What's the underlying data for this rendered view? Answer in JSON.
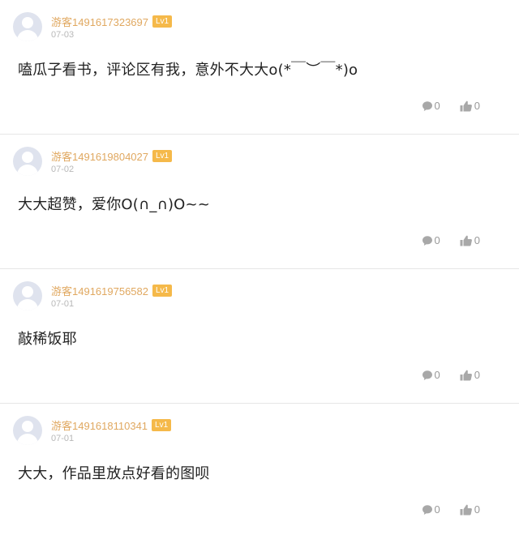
{
  "comments": [
    {
      "username": "游客1491617323697",
      "level": "Lv1",
      "date": "07-03",
      "text": "嗑瓜子看书，评论区有我，意外不大大o(*￣︶￣*)o",
      "reply_count": "0",
      "like_count": "0"
    },
    {
      "username": "游客1491619804027",
      "level": "Lv1",
      "date": "07-02",
      "text": "大大超赞，爱你O(∩_∩)O~~",
      "reply_count": "0",
      "like_count": "0"
    },
    {
      "username": "游客1491619756582",
      "level": "Lv1",
      "date": "07-01",
      "text": "敲稀饭耶",
      "reply_count": "0",
      "like_count": "0"
    },
    {
      "username": "游客1491618110341",
      "level": "Lv1",
      "date": "07-01",
      "text": "大大，作品里放点好看的图呗",
      "reply_count": "0",
      "like_count": "0"
    }
  ],
  "colors": {
    "username": "#e0a860",
    "level_badge": "#f5b94a",
    "icon": "#999999"
  },
  "icons": {
    "reply": "comment-bubble-icon",
    "like": "thumbs-up-icon"
  }
}
